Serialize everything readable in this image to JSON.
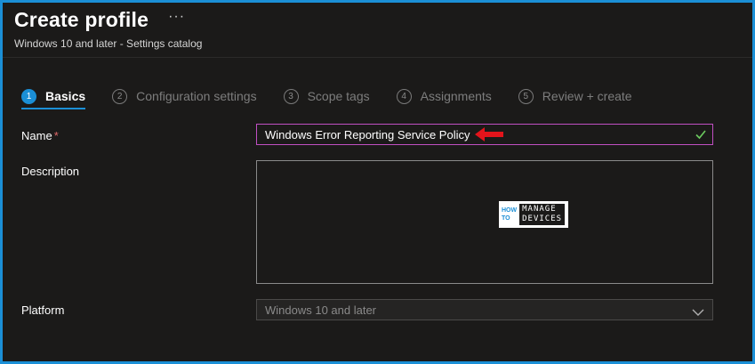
{
  "header": {
    "title": "Create profile",
    "more_label": "···",
    "subtitle": "Windows 10 and later - Settings catalog"
  },
  "steps": [
    {
      "num": "1",
      "label": "Basics",
      "active": true
    },
    {
      "num": "2",
      "label": "Configuration settings",
      "active": false
    },
    {
      "num": "3",
      "label": "Scope tags",
      "active": false
    },
    {
      "num": "4",
      "label": "Assignments",
      "active": false
    },
    {
      "num": "5",
      "label": "Review + create",
      "active": false
    }
  ],
  "form": {
    "name_label": "Name",
    "required_mark": "*",
    "name_value": "Windows Error Reporting Service Policy",
    "description_label": "Description",
    "description_value": "",
    "platform_label": "Platform",
    "platform_value": "Windows 10 and later"
  },
  "watermark": {
    "line1": "HOW",
    "line2": "TO",
    "line3": "MANAGE",
    "line4": "DEVICES"
  },
  "colors": {
    "accent": "#1b8fd6",
    "focus_border": "#c14fc3",
    "check": "#6ccb5f",
    "arrow": "#e3141b",
    "required": "#e06a6a"
  },
  "icons": {
    "check": "checkmark-icon",
    "chevron": "chevron-down-icon",
    "arrow": "red-arrow-icon"
  }
}
